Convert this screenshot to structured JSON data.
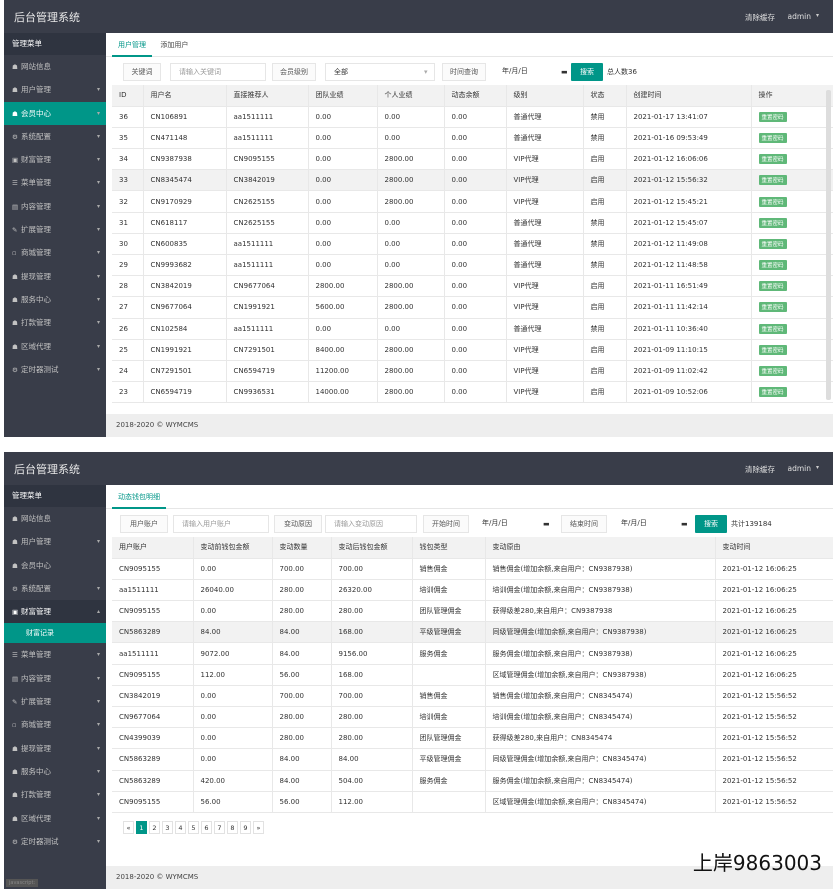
{
  "app_title": "后台管理系统",
  "clear_cache": "清除缓存",
  "user": "admin",
  "footer": "2018-2020 © WYMCMS",
  "sidebar_p1": {
    "head": "管理菜单",
    "items": [
      {
        "label": "网站信息",
        "icon": "☗",
        "arrow": ""
      },
      {
        "label": "用户管理",
        "icon": "☗",
        "arrow": "▾"
      },
      {
        "label": "会员中心",
        "icon": "☗",
        "arrow": "▾"
      },
      {
        "label": "系统配置",
        "icon": "⚙",
        "arrow": "▾"
      },
      {
        "label": "财富管理",
        "icon": "▣",
        "arrow": "▾"
      },
      {
        "label": "菜单管理",
        "icon": "☰",
        "arrow": "▾"
      },
      {
        "label": "内容管理",
        "icon": "▤",
        "arrow": "▾"
      },
      {
        "label": "扩展管理",
        "icon": "✎",
        "arrow": "▾"
      },
      {
        "label": "商城管理",
        "icon": "▫",
        "arrow": "▾"
      },
      {
        "label": "提现管理",
        "icon": "☗",
        "arrow": "▾"
      },
      {
        "label": "服务中心",
        "icon": "☗",
        "arrow": "▾"
      },
      {
        "label": "打款管理",
        "icon": "☗",
        "arrow": "▾"
      },
      {
        "label": "区域代理",
        "icon": "☗",
        "arrow": "▾"
      },
      {
        "label": "定时器测试",
        "icon": "⚙",
        "arrow": "▾"
      }
    ]
  },
  "sidebar_p2": {
    "head": "管理菜单",
    "items": [
      {
        "label": "网站信息",
        "icon": "☗",
        "arrow": ""
      },
      {
        "label": "用户管理",
        "icon": "☗",
        "arrow": "▾"
      },
      {
        "label": "会员中心",
        "icon": "☗",
        "arrow": ""
      },
      {
        "label": "系统配置",
        "icon": "⚙",
        "arrow": "▾"
      },
      {
        "label": "财富管理",
        "icon": "▣",
        "arrow": "▴"
      }
    ],
    "sub": "财富记录",
    "items2": [
      {
        "label": "菜单管理",
        "icon": "☰",
        "arrow": "▾"
      },
      {
        "label": "内容管理",
        "icon": "▤",
        "arrow": "▾"
      },
      {
        "label": "扩展管理",
        "icon": "✎",
        "arrow": "▾"
      },
      {
        "label": "商城管理",
        "icon": "▫",
        "arrow": "▾"
      },
      {
        "label": "提现管理",
        "icon": "☗",
        "arrow": "▾"
      },
      {
        "label": "服务中心",
        "icon": "☗",
        "arrow": "▾"
      },
      {
        "label": "打款管理",
        "icon": "☗",
        "arrow": "▾"
      },
      {
        "label": "区域代理",
        "icon": "☗",
        "arrow": "▾"
      },
      {
        "label": "定时器测试",
        "icon": "⚙",
        "arrow": "▾"
      }
    ]
  },
  "p1": {
    "tabs": [
      "用户管理",
      "添加用户"
    ],
    "search": {
      "kw_label": "关键词",
      "kw_placeholder": "请输入关键词",
      "level_label": "会员级别",
      "level_value": "全部",
      "time_label": "时间查询",
      "date_placeholder": "年/月/日",
      "btn": "搜索",
      "total": "总人数36"
    },
    "columns": [
      "ID",
      "用户名",
      "直接推荐人",
      "团队业绩",
      "个人业绩",
      "动态余额",
      "级别",
      "状态",
      "创建时间",
      "操作"
    ],
    "op_label": "重置密码",
    "rows": [
      [
        "36",
        "CN106891",
        "aa1511111",
        "0.00",
        "0.00",
        "0.00",
        "普通代理",
        "禁用",
        "2021-01-17 13:41:07"
      ],
      [
        "35",
        "CN471148",
        "aa1511111",
        "0.00",
        "0.00",
        "0.00",
        "普通代理",
        "禁用",
        "2021-01-16 09:53:49"
      ],
      [
        "34",
        "CN9387938",
        "CN9095155",
        "0.00",
        "2800.00",
        "0.00",
        "VIP代理",
        "启用",
        "2021-01-12 16:06:06"
      ],
      [
        "33",
        "CN8345474",
        "CN3842019",
        "0.00",
        "2800.00",
        "0.00",
        "VIP代理",
        "启用",
        "2021-01-12 15:56:32"
      ],
      [
        "32",
        "CN9170929",
        "CN2625155",
        "0.00",
        "2800.00",
        "0.00",
        "VIP代理",
        "启用",
        "2021-01-12 15:45:21"
      ],
      [
        "31",
        "CN618117",
        "CN2625155",
        "0.00",
        "0.00",
        "0.00",
        "普通代理",
        "禁用",
        "2021-01-12 15:45:07"
      ],
      [
        "30",
        "CN600835",
        "aa1511111",
        "0.00",
        "0.00",
        "0.00",
        "普通代理",
        "禁用",
        "2021-01-12 11:49:08"
      ],
      [
        "29",
        "CN9993682",
        "aa1511111",
        "0.00",
        "0.00",
        "0.00",
        "普通代理",
        "禁用",
        "2021-01-12 11:48:58"
      ],
      [
        "28",
        "CN3842019",
        "CN9677064",
        "2800.00",
        "2800.00",
        "0.00",
        "VIP代理",
        "启用",
        "2021-01-11 16:51:49"
      ],
      [
        "27",
        "CN9677064",
        "CN1991921",
        "5600.00",
        "2800.00",
        "0.00",
        "VIP代理",
        "启用",
        "2021-01-11 11:42:14"
      ],
      [
        "26",
        "CN102584",
        "aa1511111",
        "0.00",
        "0.00",
        "0.00",
        "普通代理",
        "禁用",
        "2021-01-11 10:36:40"
      ],
      [
        "25",
        "CN1991921",
        "CN7291501",
        "8400.00",
        "2800.00",
        "0.00",
        "VIP代理",
        "启用",
        "2021-01-09 11:10:15"
      ],
      [
        "24",
        "CN7291501",
        "CN6594719",
        "11200.00",
        "2800.00",
        "0.00",
        "VIP代理",
        "启用",
        "2021-01-09 11:02:42"
      ],
      [
        "23",
        "CN6594719",
        "CN9936531",
        "14000.00",
        "2800.00",
        "0.00",
        "VIP代理",
        "启用",
        "2021-01-09 10:52:06"
      ]
    ]
  },
  "p2": {
    "tabs": [
      "动态钱包明细"
    ],
    "search": {
      "acct_label": "用户账户",
      "acct_placeholder": "请输入用户账户",
      "reason_label": "变动原因",
      "reason_placeholder": "请输入变动原因",
      "start_label": "开始时间",
      "end_label": "结束时间",
      "date_placeholder": "年/月/日",
      "btn": "搜索",
      "total": "共计139184"
    },
    "columns": [
      "用户账户",
      "变动前钱包金额",
      "变动数量",
      "变动后钱包金额",
      "钱包类型",
      "变动原由",
      "变动时间"
    ],
    "rows": [
      [
        "CN9095155",
        "0.00",
        "700.00",
        "700.00",
        "销售佣金",
        "销售佣金(增加余额,来自用户：CN9387938)",
        "2021-01-12 16:06:25"
      ],
      [
        "aa1511111",
        "26040.00",
        "280.00",
        "26320.00",
        "培训佣金",
        "培训佣金(增加余额,来自用户：CN9387938)",
        "2021-01-12 16:06:25"
      ],
      [
        "CN9095155",
        "0.00",
        "280.00",
        "280.00",
        "团队管理佣金",
        "获得级差280,来自用户：CN9387938",
        "2021-01-12 16:06:25"
      ],
      [
        "CN5863289",
        "84.00",
        "84.00",
        "168.00",
        "平级管理佣金",
        "同级管理佣金(增加余额,来自用户：CN9387938)",
        "2021-01-12 16:06:25"
      ],
      [
        "aa1511111",
        "9072.00",
        "84.00",
        "9156.00",
        "服务佣金",
        "服务佣金(增加余额,来自用户：CN9387938)",
        "2021-01-12 16:06:25"
      ],
      [
        "CN9095155",
        "112.00",
        "56.00",
        "168.00",
        "",
        "区域管理佣金(增加余额,来自用户：CN9387938)",
        "2021-01-12 16:06:25"
      ],
      [
        "CN3842019",
        "0.00",
        "700.00",
        "700.00",
        "销售佣金",
        "销售佣金(增加余额,来自用户：CN8345474)",
        "2021-01-12 15:56:52"
      ],
      [
        "CN9677064",
        "0.00",
        "280.00",
        "280.00",
        "培训佣金",
        "培训佣金(增加余额,来自用户：CN8345474)",
        "2021-01-12 15:56:52"
      ],
      [
        "CN4399039",
        "0.00",
        "280.00",
        "280.00",
        "团队管理佣金",
        "获得级差280,来自用户：CN8345474",
        "2021-01-12 15:56:52"
      ],
      [
        "CN5863289",
        "0.00",
        "84.00",
        "84.00",
        "平级管理佣金",
        "同级管理佣金(增加余额,来自用户：CN8345474)",
        "2021-01-12 15:56:52"
      ],
      [
        "CN5863289",
        "420.00",
        "84.00",
        "504.00",
        "服务佣金",
        "服务佣金(增加余额,来自用户：CN8345474)",
        "2021-01-12 15:56:52"
      ],
      [
        "CN9095155",
        "56.00",
        "56.00",
        "112.00",
        "",
        "区域管理佣金(增加余额,来自用户：CN8345474)",
        "2021-01-12 15:56:52"
      ]
    ],
    "pager": [
      "«",
      "1",
      "2",
      "3",
      "4",
      "5",
      "6",
      "7",
      "8",
      "9",
      "»"
    ],
    "pager_current": "1"
  },
  "watermark": "上岸9863003",
  "js_badge": "javascript:"
}
